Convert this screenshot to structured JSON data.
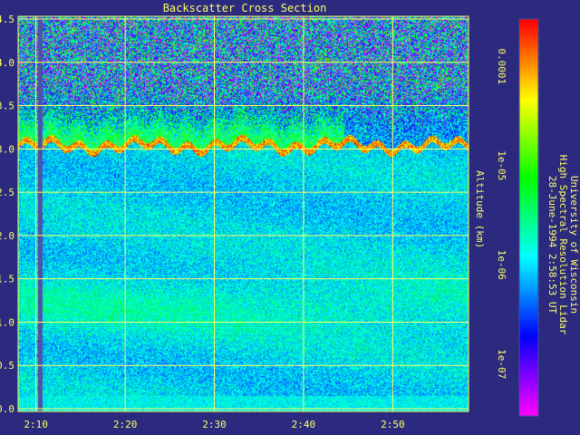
{
  "chart_data": {
    "type": "heatmap",
    "title": "Backscatter Cross Section",
    "xlabel": "",
    "ylabel": "Altitude (km)",
    "x_ticks": [
      "2:10",
      "2:20",
      "2:30",
      "2:40",
      "2:50"
    ],
    "x_range_minutes": [
      8,
      58.5
    ],
    "y_ticks": [
      "0.0",
      "0.5",
      "1.0",
      "1.5",
      "2.0",
      "2.5",
      "3.0",
      "3.5",
      "4.0",
      "4.5"
    ],
    "ylim": [
      0,
      4.5
    ],
    "grid": true,
    "colorbar": {
      "scale": "log",
      "range": [
        3e-08,
        0.0003
      ],
      "tick_labels": [
        "0.0001",
        "1e-05",
        "1e-06",
        "1e-07"
      ],
      "tick_values": [
        0.0001,
        1e-05,
        1e-06,
        1e-07
      ],
      "colors": [
        "#ff00ff",
        "#8000ff",
        "#0000ff",
        "#0080ff",
        "#00ffff",
        "#00ff80",
        "#00ff00",
        "#80ff00",
        "#ffff00",
        "#ff8000",
        "#ff0000"
      ]
    },
    "cloud_base_km": 3.0,
    "data_gap_minutes": [
      10.2,
      10.7
    ],
    "caption_lines": [
      "University of Wisconsin",
      "High Spectral Resolution Lidar",
      "28-June-1994  2:58:53 UT"
    ]
  },
  "colors": {
    "background": "#2b2a7e",
    "grid": "#ffff66",
    "text": "#ffff66"
  }
}
